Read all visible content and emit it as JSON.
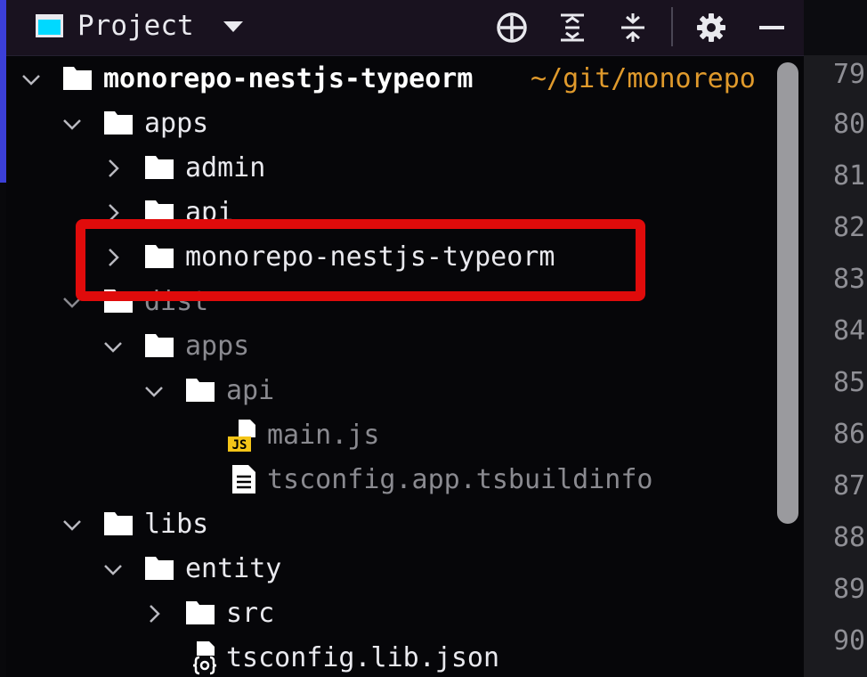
{
  "header": {
    "title": "Project",
    "buttons": [
      {
        "name": "locate-file-icon"
      },
      {
        "name": "expand-all-icon"
      },
      {
        "name": "collapse-all-icon"
      },
      {
        "name": "gear-icon"
      },
      {
        "name": "minimize-icon"
      }
    ]
  },
  "tree": {
    "root": {
      "label": "monorepo-nestjs-typeorm",
      "path": "~/git/monorepo"
    },
    "apps": {
      "label": "apps"
    },
    "admin": {
      "label": "admin"
    },
    "api": {
      "label": "api"
    },
    "monorepo_dir": {
      "label": "monorepo-nestjs-typeorm"
    },
    "dist": {
      "label": "dist"
    },
    "dist_apps": {
      "label": "apps"
    },
    "dist_api": {
      "label": "api"
    },
    "main_js": {
      "label": "main.js",
      "icon_text": "JS"
    },
    "tsbuildinfo": {
      "label": "tsconfig.app.tsbuildinfo"
    },
    "libs": {
      "label": "libs"
    },
    "entity": {
      "label": "entity"
    },
    "src": {
      "label": "src"
    },
    "tsconfig_lib": {
      "label": "tsconfig.lib.json"
    }
  },
  "gutter": {
    "line_numbers": [
      "79",
      "80",
      "81",
      "82",
      "83",
      "84",
      "85",
      "86",
      "87",
      "88",
      "89",
      "90"
    ]
  },
  "colors": {
    "primary_text": "#e9e9ee",
    "excluded_text": "#8a8a90",
    "path_text": "#e09a2c",
    "highlight": "#e00b0b",
    "js_badge": "#f5c518"
  }
}
